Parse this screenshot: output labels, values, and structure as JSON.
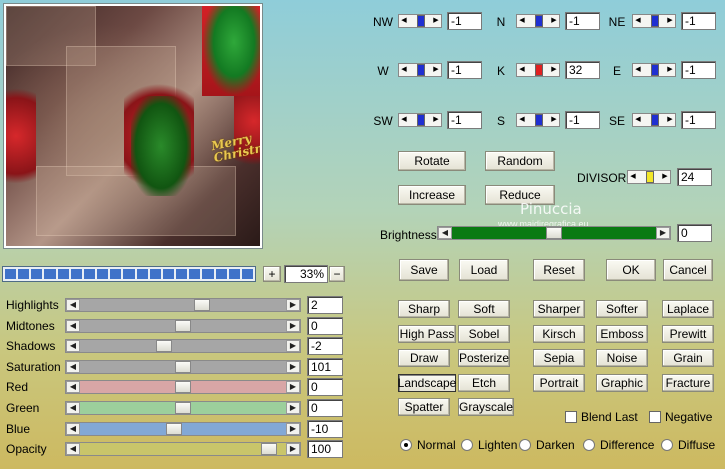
{
  "watermark": {
    "line1": "Pinuccia",
    "line2": "www.maidiregrafica.eu"
  },
  "preview": {
    "text": "Merry Christmas"
  },
  "zoom": {
    "plus": "+",
    "minus": "−",
    "value": "33%"
  },
  "sliders": [
    {
      "label": "Highlights",
      "value": "2",
      "pos": 0.6,
      "color": "#a6a6a6"
    },
    {
      "label": "Midtones",
      "value": "0",
      "pos": 0.5,
      "color": "#a6a6a6"
    },
    {
      "label": "Shadows",
      "value": "-2",
      "pos": 0.4,
      "color": "#a6a6a6"
    },
    {
      "label": "Saturation",
      "value": "101",
      "pos": 0.5,
      "color": "#a6a6a6"
    },
    {
      "label": "Red",
      "value": "0",
      "pos": 0.5,
      "color": "#d8a6a6"
    },
    {
      "label": "Green",
      "value": "0",
      "pos": 0.5,
      "color": "#9ccf9c"
    },
    {
      "label": "Blue",
      "value": "-10",
      "pos": 0.45,
      "color": "#82a8d6"
    },
    {
      "label": "Opacity",
      "value": "100",
      "pos": 0.95,
      "color": "#c9c56a"
    }
  ],
  "matrix": [
    {
      "label": "NW",
      "value": "-1",
      "color": "#1f2fd1"
    },
    {
      "label": "N",
      "value": "-1",
      "color": "#1f2fd1"
    },
    {
      "label": "NE",
      "value": "-1",
      "color": "#1f2fd1"
    },
    {
      "label": "W",
      "value": "-1",
      "color": "#1f2fd1"
    },
    {
      "label": "K",
      "value": "32",
      "color": "#e02020"
    },
    {
      "label": "E",
      "value": "-1",
      "color": "#1f2fd1"
    },
    {
      "label": "SW",
      "value": "-1",
      "color": "#1f2fd1"
    },
    {
      "label": "S",
      "value": "-1",
      "color": "#1f2fd1"
    },
    {
      "label": "SE",
      "value": "-1",
      "color": "#1f2fd1"
    }
  ],
  "buttons": {
    "rotate": "Rotate",
    "random": "Random",
    "increase": "Increase",
    "reduce": "Reduce"
  },
  "divisor": {
    "label": "DIVISOR",
    "value": "24"
  },
  "brightness": {
    "label": "Brightness",
    "value": "0"
  },
  "actions": {
    "save": "Save",
    "load": "Load",
    "reset": "Reset",
    "ok": "OK",
    "cancel": "Cancel"
  },
  "presets": [
    "Sharp",
    "Soft",
    "Sharper",
    "Softer",
    "Laplace",
    "High Pass",
    "Sobel",
    "Kirsch",
    "Emboss",
    "Prewitt",
    "Draw",
    "Posterize",
    "Sepia",
    "Noise",
    "Grain",
    "Landscape",
    "Etch",
    "Portrait",
    "Graphic",
    "Fracture",
    "Spatter",
    "Grayscale"
  ],
  "checks": {
    "blend_last": "Blend Last",
    "negative": "Negative"
  },
  "modes": [
    "Normal",
    "Lighten",
    "Darken",
    "Difference",
    "Diffuse"
  ],
  "selected_mode": "Normal"
}
